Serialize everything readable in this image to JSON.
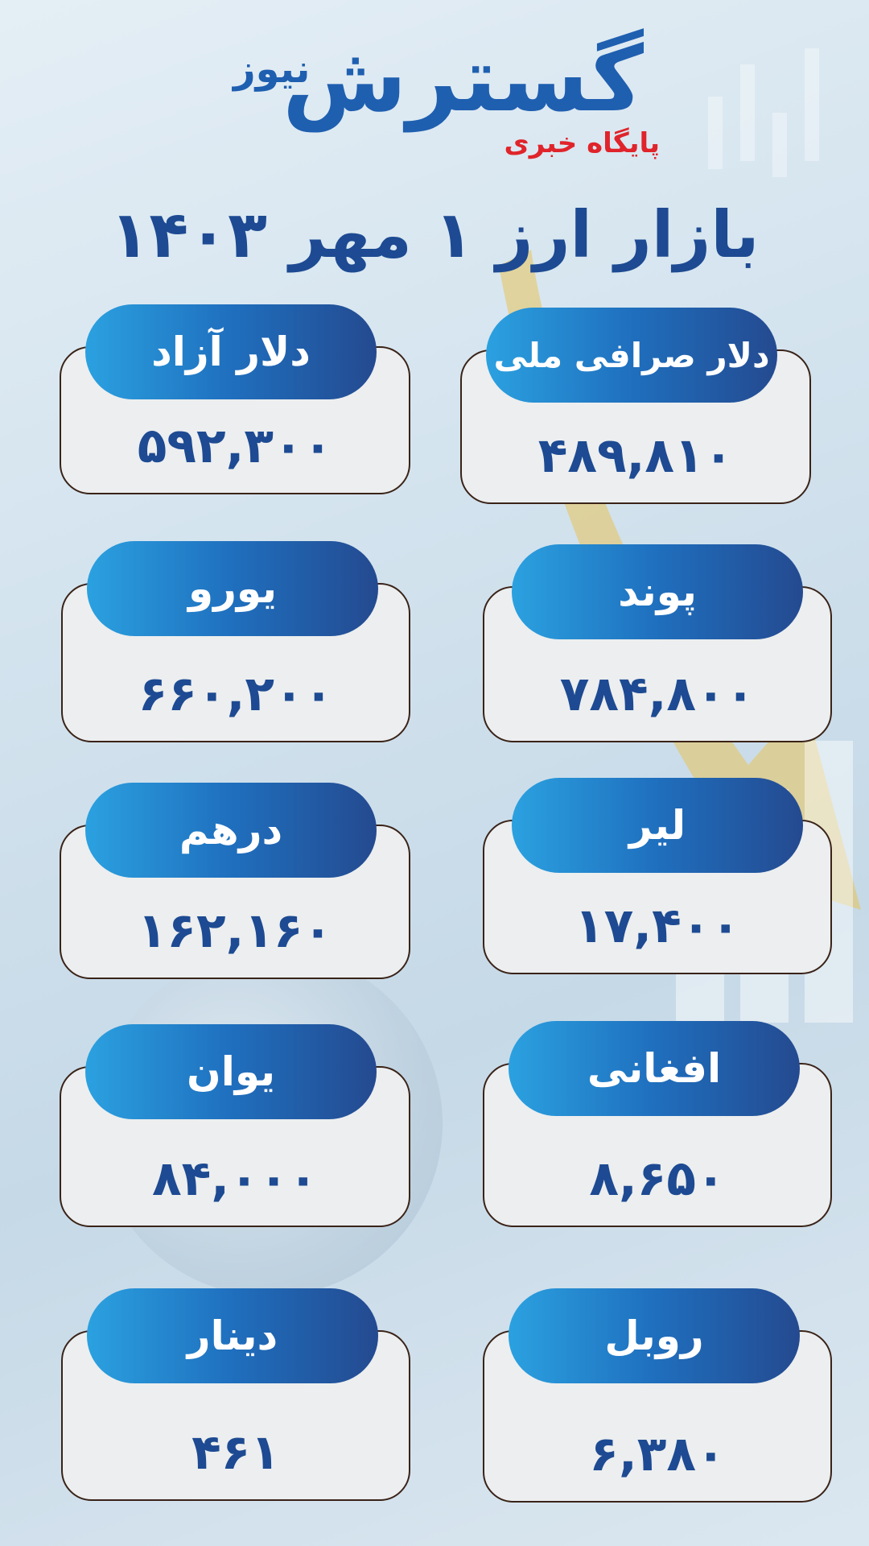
{
  "brand": {
    "logo_main": "گسترش",
    "logo_small": "نیوز",
    "tagline": "پایگاه خبری"
  },
  "title": "بازار ارز ۱ مهر ۱۴۰۳",
  "colors": {
    "title": "#1d4a92",
    "pill_start": "#2ba1e0",
    "pill_end": "#244a90",
    "card_bg": "#eceeef",
    "card_border": "#3a2318",
    "tagline": "#e0242b"
  },
  "cards": [
    {
      "label": "دلار صرافی ملی",
      "value": "۴۸۹,۸۱۰"
    },
    {
      "label": "دلار آزاد",
      "value": "۵۹۲,۳۰۰"
    },
    {
      "label": "پوند",
      "value": "۷۸۴,۸۰۰"
    },
    {
      "label": "یورو",
      "value": "۶۶۰,۲۰۰"
    },
    {
      "label": "لیر",
      "value": "۱۷,۴۰۰"
    },
    {
      "label": "درهم",
      "value": "۱۶۲,۱۶۰"
    },
    {
      "label": "افغانی",
      "value": "۸,۶۵۰"
    },
    {
      "label": "یوان",
      "value": "۸۴,۰۰۰"
    },
    {
      "label": "روبل",
      "value": "۶,۳۸۰"
    },
    {
      "label": "دینار",
      "value": "۴۶۱"
    }
  ]
}
